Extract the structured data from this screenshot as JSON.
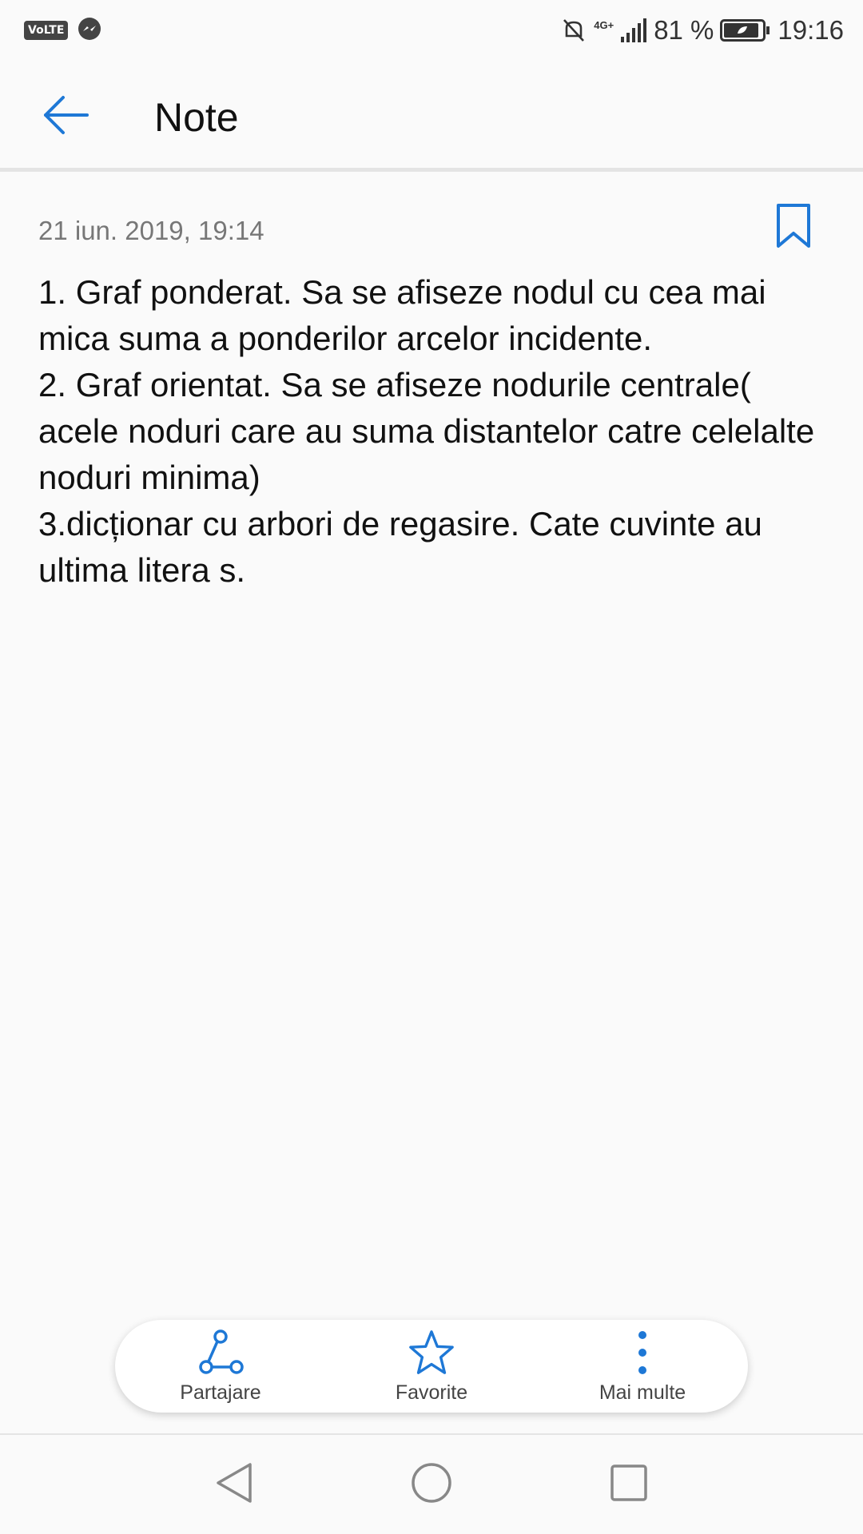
{
  "status_bar": {
    "volte": "VoLTE",
    "network": "4G+",
    "battery_percent": "81 %",
    "time": "19:16",
    "icons": [
      "volte-icon",
      "messenger-icon",
      "mute-icon",
      "signal-icon",
      "battery-icon"
    ]
  },
  "app_bar": {
    "title": "Note",
    "back_icon": "arrow-left-icon"
  },
  "note": {
    "date": "21 iun. 2019, 19:14",
    "body": "1. Graf ponderat. Sa se afiseze nodul cu cea mai mica suma a ponderilor arcelor incidente.\n2. Graf orientat. Sa se afiseze nodurile centrale( acele noduri care au suma distantelor catre celelalte noduri minima)\n3.dicționar cu arbori de regasire. Cate cuvinte au ultima litera s.",
    "bookmark_icon": "bookmark-icon"
  },
  "actions": [
    {
      "label": "Partajare",
      "icon": "share-icon"
    },
    {
      "label": "Favorite",
      "icon": "star-icon"
    },
    {
      "label": "Mai multe",
      "icon": "more-vertical-icon"
    }
  ],
  "navigation": [
    "back-triangle-icon",
    "home-circle-icon",
    "recents-square-icon"
  ],
  "colors": {
    "accent": "#1e78d6",
    "background": "#fafafa",
    "text": "#111111",
    "secondary_text": "#777777"
  }
}
